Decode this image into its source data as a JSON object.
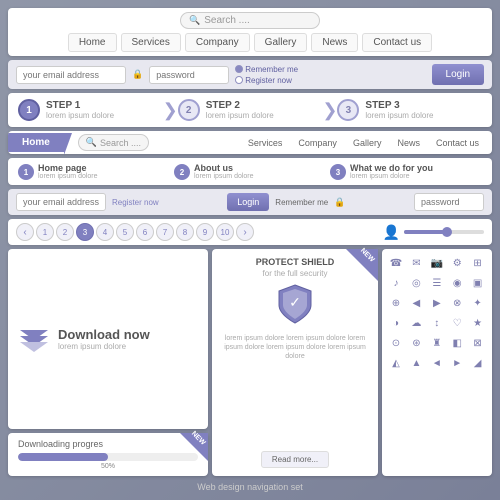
{
  "title": "Web design navigation set",
  "navbar1": {
    "search_placeholder": "Search ....",
    "tabs": [
      "Home",
      "Services",
      "Company",
      "Gallery",
      "News",
      "Contact us"
    ]
  },
  "loginbar1": {
    "email_placeholder": "your email address",
    "password_placeholder": "password",
    "remember_me": "Remember me",
    "register_now": "Register now",
    "login_label": "Login"
  },
  "steps": [
    {
      "num": "1",
      "label": "STEP 1",
      "sub": "lorem ipsum dolore"
    },
    {
      "num": "2",
      "label": "STEP 2",
      "sub": "lorem ipsum dolore"
    },
    {
      "num": "3",
      "label": "STEP 3",
      "sub": "lorem ipsum dolore"
    }
  ],
  "navbar2": {
    "home_label": "Home",
    "search_placeholder": "Search ....",
    "tabs": [
      "Services",
      "Company",
      "Gallery",
      "News",
      "Contact us"
    ]
  },
  "pagelinks": [
    {
      "num": "1",
      "label": "Home page",
      "sub": "lorem ipsum dolore"
    },
    {
      "num": "2",
      "label": "About us",
      "sub": "lorem ipsum dolore"
    },
    {
      "num": "3",
      "label": "What we do for you",
      "sub": "lorem ipsum dolore"
    }
  ],
  "loginbar2": {
    "email_placeholder": "your email address",
    "register_now": "Register now",
    "login_label": "Login",
    "remember_me": "Remember me",
    "password_placeholder": "password"
  },
  "pagination": {
    "pages": [
      "<",
      "1",
      "2",
      "3",
      "4",
      "5",
      "6",
      "7",
      "8",
      "9",
      "10",
      ">"
    ],
    "active_page": "3"
  },
  "download_card": {
    "title": "Download now",
    "subtitle": "lorem ipsum dolore"
  },
  "progress_card": {
    "label": "Downloading progres",
    "percent": "50%",
    "new_badge": "NEW"
  },
  "shield_card": {
    "title": "PROTECT SHIELD",
    "subtitle": "for the full security",
    "description": "lorem ipsum dolore lorem ipsum dolore lorem ipsum dolore lorem ipsum dolore lorem ipsum dolore",
    "read_more": "Read more...",
    "new_badge": "NEW"
  },
  "icons": [
    "☎",
    "✉",
    "📷",
    "⚙",
    "⊞",
    "♪",
    "◎",
    "☰",
    "◉",
    "▣",
    "⊕",
    "◀",
    "▶",
    "⊗",
    "✦",
    "◑",
    "☁",
    "↕",
    "♡",
    "★",
    "⊙",
    "⊛",
    "♜",
    "◧",
    "⊠",
    "◭",
    "▲",
    "◄",
    "►",
    "◢"
  ]
}
